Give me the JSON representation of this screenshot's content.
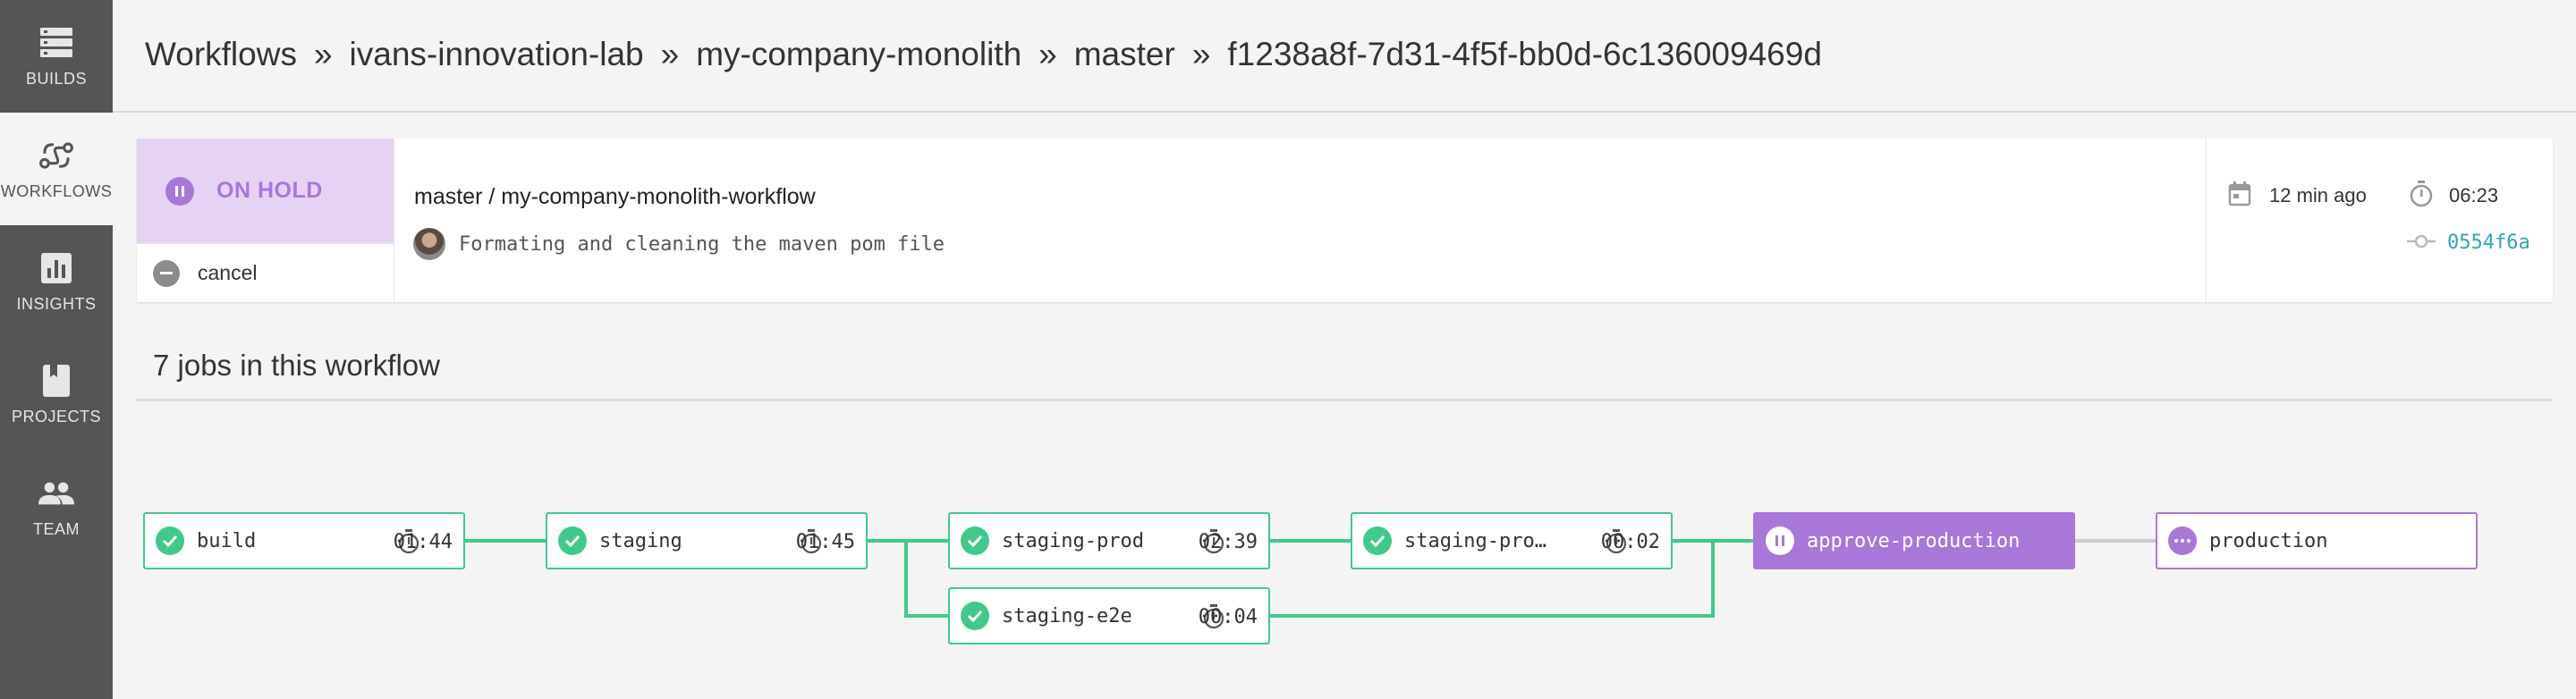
{
  "sidebar": {
    "items": [
      {
        "label": "Builds",
        "icon": "builds-icon"
      },
      {
        "label": "Workflows",
        "icon": "workflows-icon",
        "active": true
      },
      {
        "label": "Insights",
        "icon": "insights-icon"
      },
      {
        "label": "Projects",
        "icon": "projects-icon"
      },
      {
        "label": "Team",
        "icon": "team-icon"
      }
    ]
  },
  "header": {
    "breadcrumb": [
      "Workflows",
      "ivans-innovation-lab",
      "my-company-monolith",
      "master",
      "f1238a8f-7d31-4f5f-bb0d-6c136009469d"
    ],
    "separator": "»"
  },
  "workflow": {
    "status": "ON HOLD",
    "cancel_label": "cancel",
    "title": "master / my-company-monolith-workflow",
    "commit_message": "Formating and cleaning the maven pom file",
    "time_ago": "12 min ago",
    "duration": "06:23",
    "commit_sha": "0554f6a"
  },
  "jobs_title": "7 jobs in this workflow",
  "jobs": [
    {
      "name": "build",
      "time": "01:44",
      "status": "success"
    },
    {
      "name": "staging",
      "time": "01:45",
      "status": "success"
    },
    {
      "name": "staging-prod",
      "time": "02:39",
      "status": "success"
    },
    {
      "name": "staging-prod…",
      "time": "00:02",
      "status": "success"
    },
    {
      "name": "staging-e2e",
      "time": "00:04",
      "status": "success"
    },
    {
      "name": "approve-production",
      "time": "",
      "status": "on-hold"
    },
    {
      "name": "production",
      "time": "",
      "status": "blocked"
    }
  ],
  "colors": {
    "success": "#42c88a",
    "hold": "#a977d8",
    "hold_bg": "#e6d3f3",
    "link": "#2fa4b6",
    "sidebar": "#555555"
  }
}
